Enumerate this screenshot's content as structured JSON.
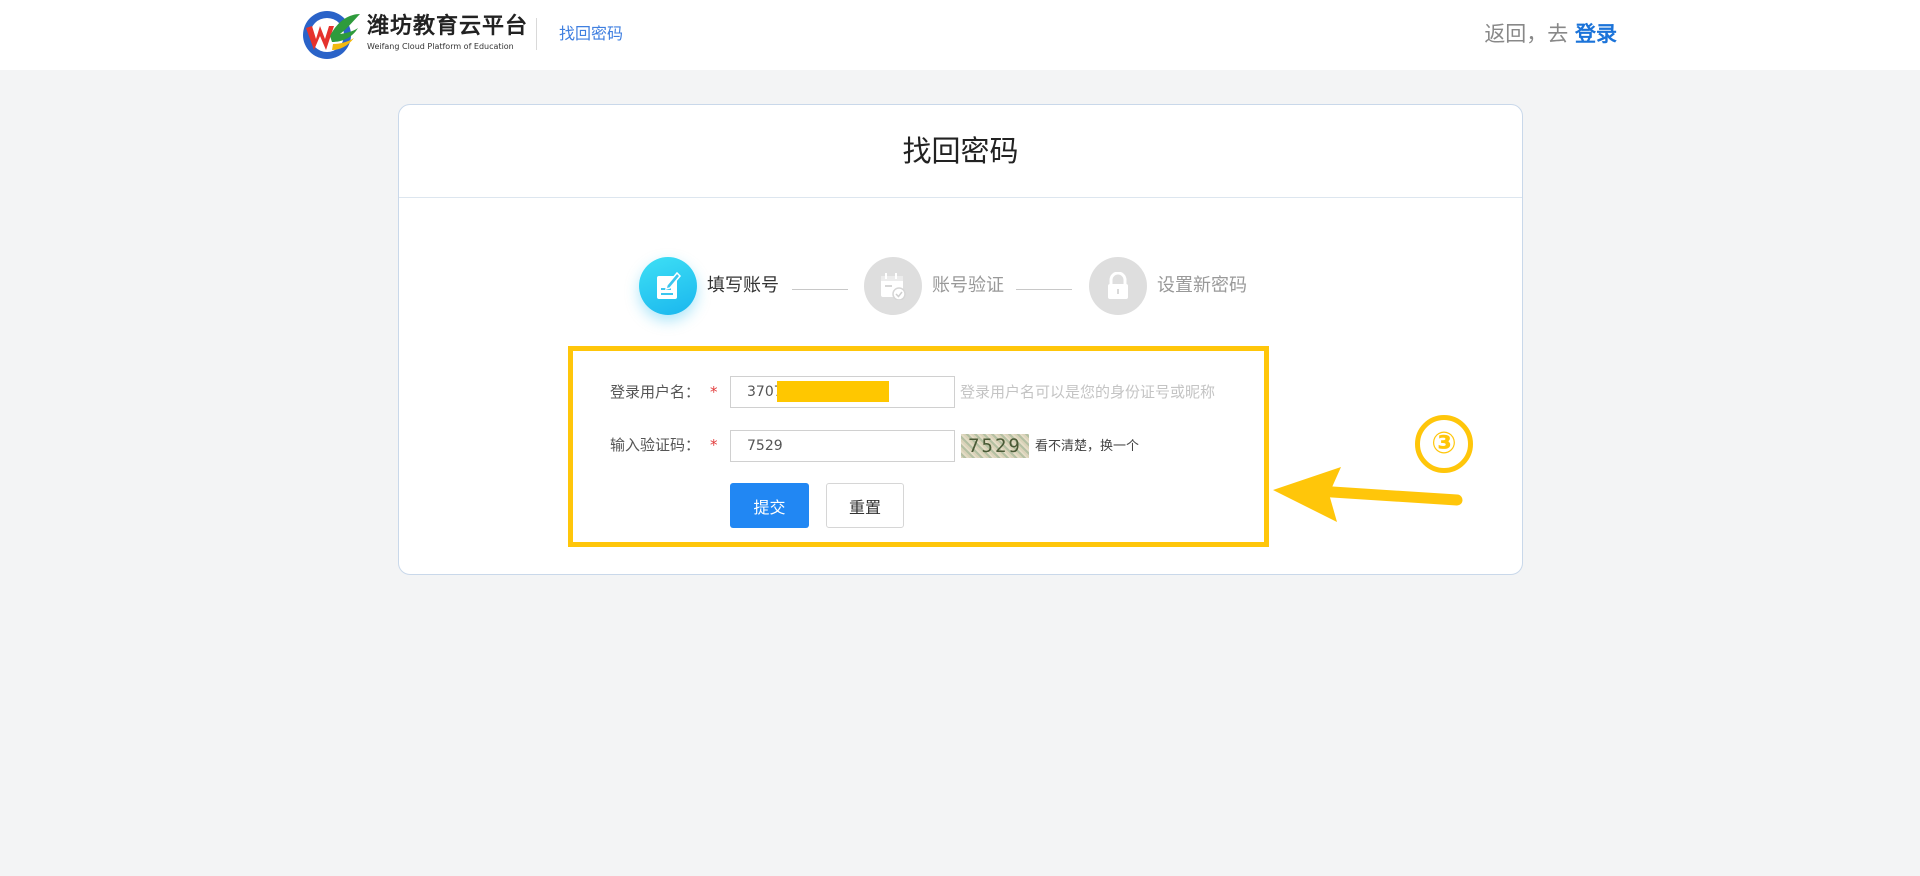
{
  "header": {
    "brand_cn": "潍坊教育云平台",
    "brand_en": "Weifang Cloud Platform of Education",
    "subtitle": "找回密码",
    "back_text": "返回，去",
    "login_link": "登录"
  },
  "card": {
    "title": "找回密码"
  },
  "steps": [
    {
      "label": "填写账号",
      "state": "active",
      "icon": "edit-document-icon"
    },
    {
      "label": "账号验证",
      "state": "inactive",
      "icon": "calendar-check-icon"
    },
    {
      "label": "设置新密码",
      "state": "inactive",
      "icon": "lock-icon"
    }
  ],
  "form": {
    "username": {
      "label": "登录用户名：",
      "required_mark": "*",
      "value": "3707",
      "hint": "登录用户名可以是您的身份证号或昵称"
    },
    "captcha": {
      "label": "输入验证码：",
      "required_mark": "*",
      "value": "7529",
      "image_text": "7529",
      "refresh_text": "看不清楚，换一个"
    },
    "submit_label": "提交",
    "reset_label": "重置"
  },
  "annotation": {
    "number": "③"
  },
  "colors": {
    "accent": "#2187f3",
    "active_step": "#1ab6ee",
    "annotation": "#ffc60a",
    "required": "#e23c3c"
  }
}
